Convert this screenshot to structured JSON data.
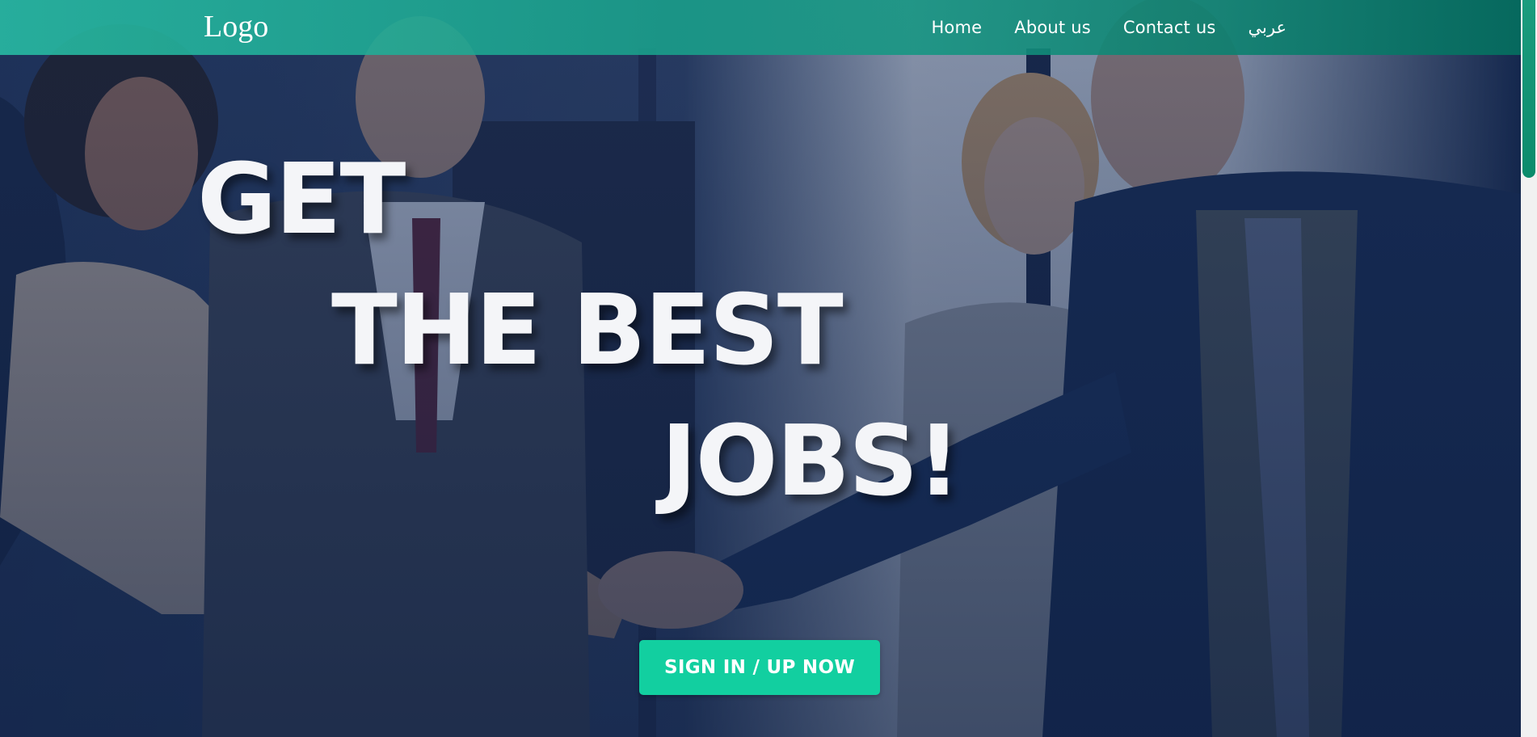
{
  "header": {
    "logo_text": "Logo",
    "nav": [
      {
        "label": "Home"
      },
      {
        "label": "About us"
      },
      {
        "label": "Contact us"
      },
      {
        "label": "عربي"
      }
    ]
  },
  "hero": {
    "headline": [
      "GET",
      "THE BEST",
      "JOBS!"
    ],
    "cta_label": "SIGN IN / UP NOW",
    "background_image": "business-people-handshake-photo"
  },
  "colors": {
    "nav_background": "#1fae95",
    "cta_background": "#12cfa0",
    "headline_text": "#f4f5f8",
    "overlay": "#102b5a"
  }
}
